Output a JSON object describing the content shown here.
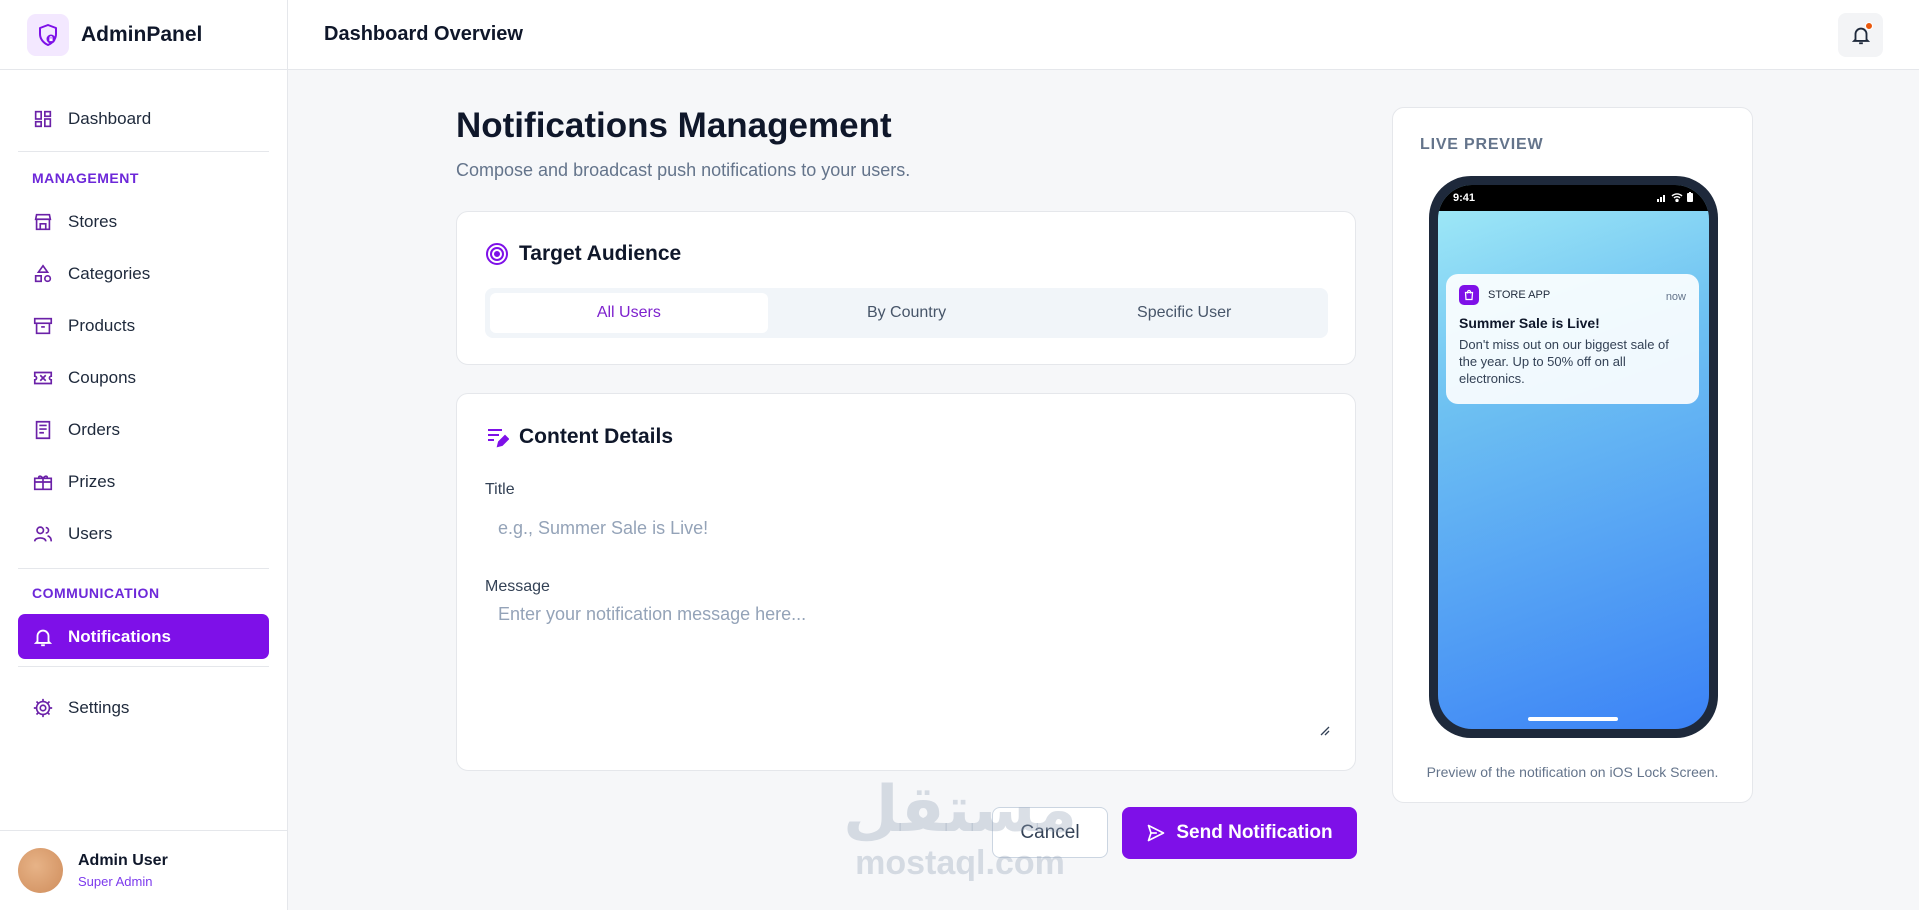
{
  "brand": {
    "name": "AdminPanel"
  },
  "topbar": {
    "title": "Dashboard Overview"
  },
  "sidebar": {
    "dashboard": "Dashboard",
    "management_label": "MANAGEMENT",
    "management_items": [
      "Stores",
      "Categories",
      "Products",
      "Coupons",
      "Orders",
      "Prizes",
      "Users"
    ],
    "communication_label": "COMMUNICATION",
    "notifications": "Notifications",
    "settings": "Settings"
  },
  "user": {
    "name": "Admin User",
    "role": "Super Admin"
  },
  "main": {
    "title": "Notifications Management",
    "subtitle": "Compose and broadcast push notifications to your users."
  },
  "audience": {
    "heading": "Target Audience",
    "options": [
      "All Users",
      "By Country",
      "Specific User"
    ],
    "selected": "All Users"
  },
  "content": {
    "heading": "Content Details",
    "title_label": "Title",
    "title_placeholder": "e.g., Summer Sale is Live!",
    "message_label": "Message",
    "message_placeholder": "Enter your notification message here..."
  },
  "actions": {
    "cancel": "Cancel",
    "send": "Send Notification"
  },
  "preview": {
    "label": "LIVE PREVIEW",
    "time": "9:41",
    "app_name": "STORE APP",
    "notif_time": "now",
    "notif_title": "Summer Sale is Live!",
    "notif_body": "Don't miss out on our biggest sale of the year. Up to 50% off on all electronics.",
    "caption": "Preview of the notification on iOS Lock Screen."
  },
  "watermark": {
    "arabic": "مستقل",
    "latin": "mostaql.com"
  },
  "colors": {
    "accent": "#7e10e8",
    "accent_light": "#f3e8ff",
    "notification_dot": "#ea580c"
  },
  "icons": {
    "brand": "shield-lock-icon",
    "dashboard": "grid-icon",
    "stores": "store-icon",
    "categories": "shapes-icon",
    "products": "archive-icon",
    "coupons": "ticket-icon",
    "orders": "receipt-icon",
    "prizes": "gift-icon",
    "users": "users-icon",
    "notifications": "bell-icon",
    "settings": "gear-icon",
    "target": "target-icon",
    "content": "edit-list-icon",
    "send": "send-icon"
  }
}
